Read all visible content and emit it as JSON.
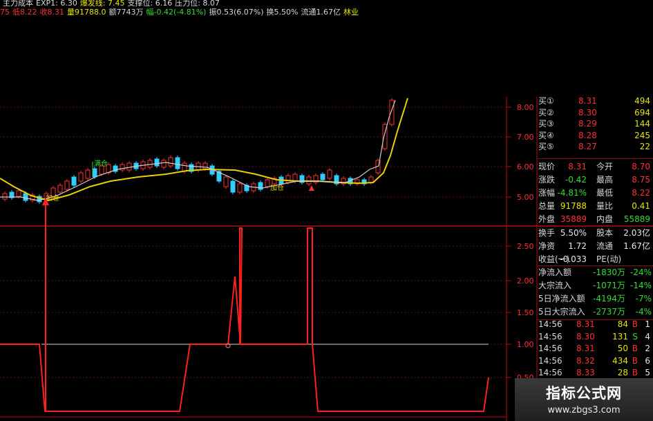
{
  "header": {
    "line1": [
      {
        "text": "主力成本",
        "color": "#d8d8d8"
      },
      {
        "text": "EXP1: 6.30",
        "color": "#d8d8d8"
      },
      {
        "text": "爆发线: 7.45",
        "color": "#e6e600"
      },
      {
        "text": "支撑位: 6.16",
        "color": "#d8d8d8"
      },
      {
        "text": "压力位: 8.07",
        "color": "#d8d8d8"
      }
    ],
    "line2": [
      {
        "text": "75",
        "color": "#ff3030"
      },
      {
        "text": "低8.22",
        "color": "#ff3030"
      },
      {
        "text": "收8.31",
        "color": "#ff3030"
      },
      {
        "text": "量91788.0",
        "color": "#e6e600"
      },
      {
        "text": "额7743万",
        "color": "#d8d8d8"
      },
      {
        "text": "幅-0.42(-4.81%)",
        "color": "#33dd33"
      },
      {
        "text": "振0.53(6.07%)",
        "color": "#d8d8d8"
      },
      {
        "text": "换5.50%",
        "color": "#d8d8d8"
      },
      {
        "text": "流通1.67亿",
        "color": "#d8d8d8"
      },
      {
        "text": "林业",
        "color": "#e6e600"
      }
    ]
  },
  "price_axis": [
    "8.00",
    "7.00",
    "6.00",
    "5.00"
  ],
  "indicator_axis": [
    "2.50",
    "2.00",
    "1.50",
    "1.00",
    "0.50"
  ],
  "chart_labels": {
    "add1": "满仓",
    "add2": "加仓",
    "add3": "加仓"
  },
  "order_book": [
    {
      "label": "买①",
      "price": "8.31",
      "vol": "494"
    },
    {
      "label": "买②",
      "price": "8.30",
      "vol": "694"
    },
    {
      "label": "买③",
      "price": "8.29",
      "vol": "144"
    },
    {
      "label": "买④",
      "price": "8.28",
      "vol": "245"
    },
    {
      "label": "买⑤",
      "price": "8.27",
      "vol": "22"
    }
  ],
  "quote": [
    {
      "k1": "现价",
      "v1": "8.31",
      "c1": "#ff3030",
      "k2": "今开",
      "v2": "8.70",
      "c2": "#ff3030"
    },
    {
      "k1": "涨跌",
      "v1": "-0.42",
      "c1": "#33dd33",
      "k2": "最高",
      "v2": "8.75",
      "c2": "#ff3030"
    },
    {
      "k1": "涨幅",
      "v1": "-4.81%",
      "c1": "#33dd33",
      "k2": "最低",
      "v2": "8.22",
      "c2": "#ff3030"
    },
    {
      "k1": "总量",
      "v1": "91788",
      "c1": "#e6e600",
      "k2": "量比",
      "v2": "0.41",
      "c2": "#e6e600"
    },
    {
      "k1": "外盘",
      "v1": "35889",
      "c1": "#ff3030",
      "k2": "内盘",
      "v2": "55889",
      "c2": "#33dd33"
    }
  ],
  "fundamentals": [
    {
      "k1": "换手",
      "v1": "5.50%",
      "k2": "股本",
      "v2": "2.03亿"
    },
    {
      "k1": "净资",
      "v1": "1.72",
      "k2": "流通",
      "v2": "1.67亿"
    },
    {
      "k1": "收益(一)",
      "v1": "-0.033",
      "k2": "PE(动)",
      "v2": ""
    }
  ],
  "flows": [
    {
      "k": "净流入额",
      "v": "-1830万",
      "p": "-24%"
    },
    {
      "k": "大宗流入",
      "v": "-1071万",
      "p": "-14%"
    },
    {
      "k": "5日净流入额",
      "v": "-4194万",
      "p": "-7%"
    },
    {
      "k": "5日大宗流入",
      "v": "-2737万",
      "p": "-4%"
    }
  ],
  "ticks": [
    {
      "t": "14:56",
      "p": "8.31",
      "v": "84",
      "s": "B",
      "sc": "#ff3030",
      "n": "1"
    },
    {
      "t": "14:56",
      "p": "8.30",
      "v": "131",
      "s": "S",
      "sc": "#33dd33",
      "n": "4"
    },
    {
      "t": "14:56",
      "p": "8.31",
      "v": "50",
      "s": "B",
      "sc": "#ff3030",
      "n": "2"
    },
    {
      "t": "14:56",
      "p": "8.32",
      "v": "434",
      "s": "B",
      "sc": "#ff3030",
      "n": "6"
    },
    {
      "t": "14:56",
      "p": "8.33",
      "v": "28",
      "s": "B",
      "sc": "#ff3030",
      "n": "5"
    }
  ],
  "watermark": {
    "title": "指标公式网",
    "url": "www.zbgs3.com"
  }
}
